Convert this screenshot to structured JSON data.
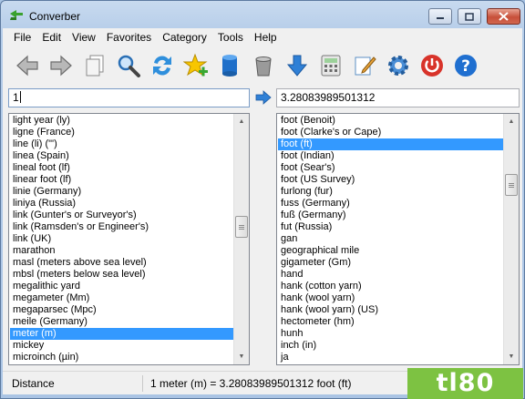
{
  "window": {
    "title": "Converber"
  },
  "menu": [
    "File",
    "Edit",
    "View",
    "Favorites",
    "Category",
    "Tools",
    "Help"
  ],
  "toolbar": [
    {
      "name": "back-icon"
    },
    {
      "name": "forward-icon"
    },
    {
      "name": "copy-icon"
    },
    {
      "name": "search-icon"
    },
    {
      "name": "swap-icon"
    },
    {
      "name": "add-favorite-icon"
    },
    {
      "name": "database-icon"
    },
    {
      "name": "trash-icon"
    },
    {
      "name": "download-icon"
    },
    {
      "name": "calculator-icon"
    },
    {
      "name": "edit-icon"
    },
    {
      "name": "settings-icon"
    },
    {
      "name": "power-icon"
    },
    {
      "name": "help-icon"
    }
  ],
  "input": {
    "value": "1"
  },
  "output": {
    "value": "3.28083989501312"
  },
  "from_units": [
    "light year (ly)",
    "ligne (France)",
    "line (li) (\"')",
    "linea (Spain)",
    "lineal foot (lf)",
    "linear foot (lf)",
    "linie (Germany)",
    "liniya (Russia)",
    "link (Gunter's or Surveyor's)",
    "link (Ramsden's or Engineer's)",
    "link (UK)",
    "marathon",
    "masl (meters above sea level)",
    "mbsl (meters below sea level)",
    "megalithic yard",
    "megameter (Mm)",
    "megaparsec (Mpc)",
    "meile (Germany)",
    "meter (m)",
    "mickey",
    "microinch (µin)"
  ],
  "from_selected": "meter (m)",
  "to_units": [
    "foot (Benoit)",
    "foot (Clarke's or Cape)",
    "foot (ft)",
    "foot (Indian)",
    "foot (Sear's)",
    "foot (US Survey)",
    "furlong (fur)",
    "fuss (Germany)",
    "fuß (Germany)",
    "fut (Russia)",
    "gan",
    "geographical mile",
    "gigameter (Gm)",
    "hand",
    "hank (cotton yarn)",
    "hank (wool yarn)",
    "hank (wool yarn) (US)",
    "hectometer (hm)",
    "hunh",
    "inch (in)",
    "ja"
  ],
  "to_selected": "foot (ft)",
  "status": {
    "category": "Distance",
    "result": "1 meter (m) = 3.28083989501312 foot (ft)"
  },
  "watermark": "tl80",
  "colors": {
    "selection": "#3399ff",
    "watermark_bg": "#7dc242"
  }
}
